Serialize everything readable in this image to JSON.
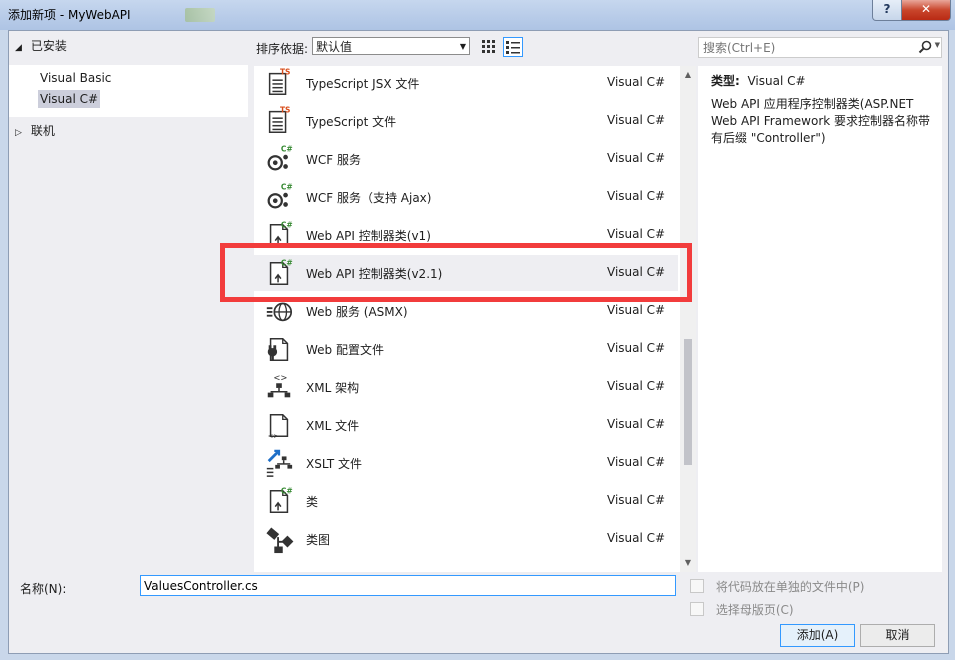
{
  "window": {
    "title": "添加新项 - MyWebAPI",
    "help": "?",
    "close": "✕"
  },
  "sidebar": {
    "installed": "已安装",
    "children": [
      "Visual Basic",
      "Visual C#"
    ],
    "online": "联机"
  },
  "toolbar": {
    "sort_label": "排序依据:",
    "sort_value": "默认值"
  },
  "search": {
    "placeholder": "搜索(Ctrl+E)"
  },
  "templates": [
    {
      "name": "TypeScript JSX 文件",
      "lang": "Visual C#",
      "icon": "typescript-file-icon"
    },
    {
      "name": "TypeScript 文件",
      "lang": "Visual C#",
      "icon": "typescript-file-icon"
    },
    {
      "name": "WCF 服务",
      "lang": "Visual C#",
      "icon": "wcf-service-icon"
    },
    {
      "name": "WCF 服务（支持 Ajax)",
      "lang": "Visual C#",
      "icon": "wcf-service-icon"
    },
    {
      "name": "Web API 控制器类(v1)",
      "lang": "Visual C#",
      "icon": "controller-class-icon"
    },
    {
      "name": "Web API 控制器类(v2.1)",
      "lang": "Visual C#",
      "icon": "controller-class-icon"
    },
    {
      "name": "Web 服务 (ASMX)",
      "lang": "Visual C#",
      "icon": "web-service-icon"
    },
    {
      "name": "Web 配置文件",
      "lang": "Visual C#",
      "icon": "web-config-icon"
    },
    {
      "name": "XML 架构",
      "lang": "Visual C#",
      "icon": "xml-schema-icon"
    },
    {
      "name": "XML 文件",
      "lang": "Visual C#",
      "icon": "xml-file-icon"
    },
    {
      "name": "XSLT 文件",
      "lang": "Visual C#",
      "icon": "xslt-file-icon"
    },
    {
      "name": "类",
      "lang": "Visual C#",
      "icon": "class-icon"
    },
    {
      "name": "类图",
      "lang": "Visual C#",
      "icon": "class-diagram-icon"
    }
  ],
  "info": {
    "type_label": "类型:",
    "type_value": "Visual C#",
    "description": "Web API 应用程序控制器类(ASP.NET Web API Framework 要求控制器名称带有后缀 \"Controller\")"
  },
  "form": {
    "name_label": "名称(N):",
    "name_value": "ValuesController.cs",
    "separate_file": "将代码放在单独的文件中(P)",
    "master_page": "选择母版页(C)",
    "add": "添加(A)",
    "cancel": "取消"
  },
  "colors": {
    "highlight_frame": "#f23c3c",
    "csharp_badge": "#388a34",
    "ts_badge": "#d84c1a",
    "focus": "#3399ff"
  }
}
